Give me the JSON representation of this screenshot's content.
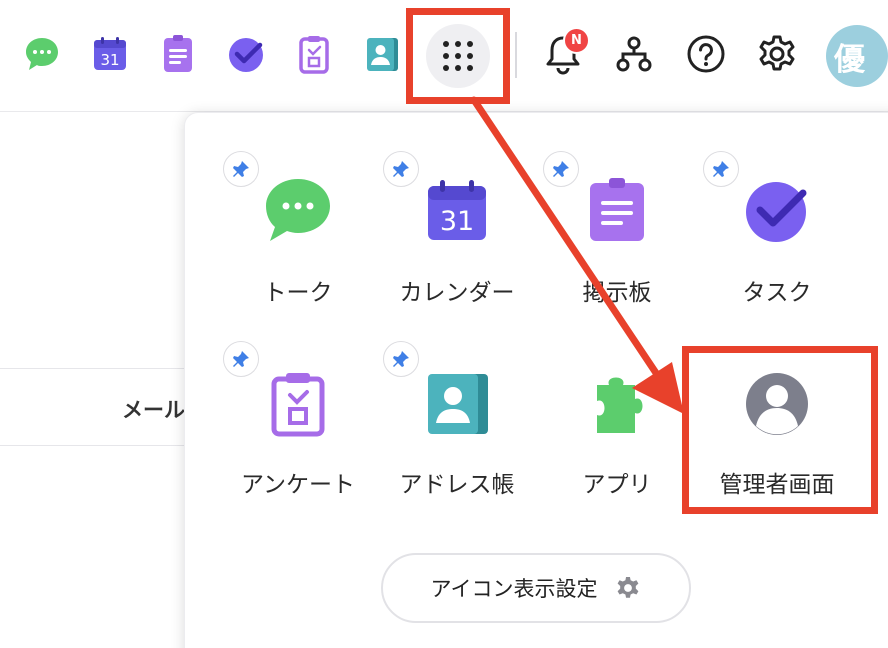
{
  "topbar": {
    "badge_text": "N",
    "avatar_text": "優",
    "icons": [
      "talk-icon",
      "calendar-icon",
      "board-icon",
      "task-icon",
      "survey-icon",
      "address-book-icon",
      "apps-grid-icon",
      "bell-icon",
      "org-chart-icon",
      "help-icon",
      "settings-icon"
    ],
    "calendar_number": "31"
  },
  "background": {
    "mail_label": "メール"
  },
  "popup": {
    "apps": [
      {
        "label": "トーク",
        "icon": "talk-icon",
        "pinned": true
      },
      {
        "label": "カレンダー",
        "icon": "calendar-icon",
        "pinned": true,
        "number": "31"
      },
      {
        "label": "掲示板",
        "icon": "board-icon",
        "pinned": true
      },
      {
        "label": "タスク",
        "icon": "task-icon",
        "pinned": true
      },
      {
        "label": "アンケート",
        "icon": "survey-icon",
        "pinned": true
      },
      {
        "label": "アドレス帳",
        "icon": "address-book-icon",
        "pinned": true
      },
      {
        "label": "アプリ",
        "icon": "puzzle-icon",
        "pinned": false
      },
      {
        "label": "管理者画面",
        "icon": "admin-user-icon",
        "pinned": false
      }
    ],
    "settings_button_label": "アイコン表示設定"
  },
  "annotation": {
    "color": "#e8412b",
    "targets": [
      "apps-grid-button",
      "admin-screen-tile"
    ]
  },
  "colors": {
    "talk": "#5ccd6d",
    "calendar": "#6a5de8",
    "board": "#a772ee",
    "task": "#7a60f0",
    "survey": "#a66ce8",
    "address_book": "#4cb3bd",
    "puzzle": "#5ccd6d",
    "admin": "#7d7f8c",
    "pin": "#3f7fe6",
    "badge": "#f04444",
    "avatar": "#9ccfde"
  }
}
